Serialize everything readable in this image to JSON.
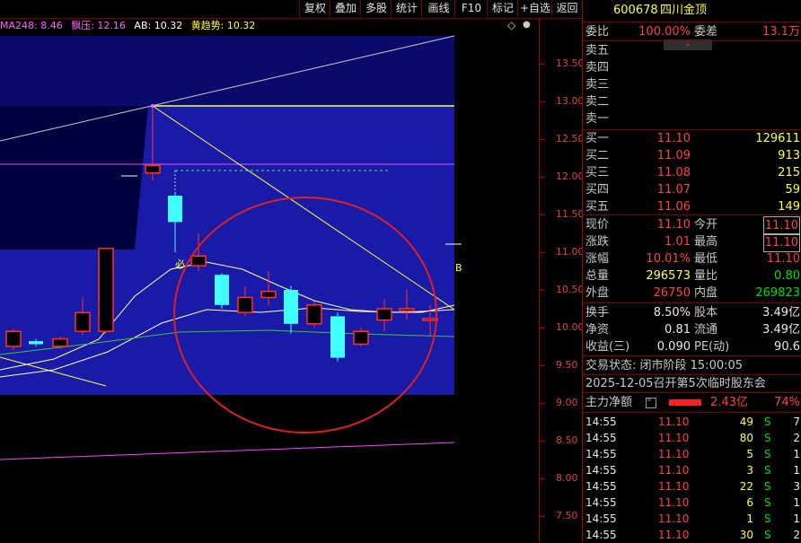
{
  "toolbar": {
    "buttons": [
      "复权",
      "叠加",
      "多股",
      "统计",
      "画线",
      "F10",
      "标记",
      "+自选",
      "返回"
    ]
  },
  "indicators": {
    "ma248": "MA248: 8.46",
    "piaoya": "飘压: 12.16",
    "ab": "AB: 10.32",
    "huang": "黄趋势: 10.32"
  },
  "chart_icons": {
    "diamond": "◇",
    "dot": "●"
  },
  "price_axis": {
    "ticks": [
      "13.50",
      "13.00",
      "12.50",
      "12.00",
      "11.50",
      "11.00",
      "10.50",
      "10.00",
      "9.50",
      "9.00",
      "8.50",
      "8.00",
      "7.50"
    ]
  },
  "chart_labels": {
    "signal": "必",
    "b_mark": "B"
  },
  "chart_data": {
    "type": "candlestick",
    "ylim": [
      7.25,
      13.85
    ],
    "candles": [
      {
        "o": 9.75,
        "c": 9.95,
        "h": 9.98,
        "l": 9.7
      },
      {
        "o": 9.82,
        "c": 9.78,
        "h": 9.85,
        "l": 9.75
      },
      {
        "o": 9.75,
        "c": 9.85,
        "h": 9.88,
        "l": 9.72
      },
      {
        "o": 9.95,
        "c": 10.2,
        "h": 10.4,
        "l": 9.9
      },
      {
        "o": 9.95,
        "c": 11.05,
        "h": 11.05,
        "l": 9.92
      },
      {
        "o": 12.05,
        "c": 12.15,
        "h": 12.95,
        "l": 11.95
      },
      {
        "o": 11.75,
        "c": 11.4,
        "h": 11.8,
        "l": 11.0
      },
      {
        "o": 10.82,
        "c": 10.95,
        "h": 11.25,
        "l": 10.75
      },
      {
        "o": 10.7,
        "c": 10.3,
        "h": 10.72,
        "l": 10.25
      },
      {
        "o": 10.2,
        "c": 10.4,
        "h": 10.55,
        "l": 10.15
      },
      {
        "o": 10.4,
        "c": 10.48,
        "h": 10.75,
        "l": 10.3
      },
      {
        "o": 10.5,
        "c": 10.05,
        "h": 10.55,
        "l": 9.92
      },
      {
        "o": 10.05,
        "c": 10.3,
        "h": 10.35,
        "l": 10.0
      },
      {
        "o": 10.15,
        "c": 9.6,
        "h": 10.2,
        "l": 9.55
      },
      {
        "o": 9.78,
        "c": 9.95,
        "h": 10.0,
        "l": 9.75
      },
      {
        "o": 10.1,
        "c": 10.25,
        "h": 10.38,
        "l": 9.95
      },
      {
        "o": 10.22,
        "c": 10.25,
        "h": 10.5,
        "l": 10.1
      },
      {
        "o": 10.1,
        "c": 10.12,
        "h": 10.3,
        "l": 9.9
      }
    ]
  },
  "panel": {
    "code": "600678",
    "name": "四川金顶",
    "weibi_label": "委比",
    "weibi": "100.00%",
    "weicha_label": "委差",
    "weicha": "13.1万",
    "sell": [
      {
        "label": "卖五"
      },
      {
        "label": "卖四"
      },
      {
        "label": "卖三"
      },
      {
        "label": "卖二"
      },
      {
        "label": "卖一"
      }
    ],
    "buy": [
      {
        "label": "买一",
        "price": "11.10",
        "vol": "129611"
      },
      {
        "label": "买二",
        "price": "11.09",
        "vol": "913"
      },
      {
        "label": "买三",
        "price": "11.08",
        "vol": "215"
      },
      {
        "label": "买四",
        "price": "11.07",
        "vol": "59"
      },
      {
        "label": "买五",
        "price": "11.06",
        "vol": "149"
      }
    ],
    "quote": [
      {
        "l1": "现价",
        "v1": "11.10",
        "l2": "今开",
        "v2": "11.10"
      },
      {
        "l1": "涨跌",
        "v1": "1.01",
        "l2": "最高",
        "v2": "11.10"
      },
      {
        "l1": "涨幅",
        "v1": "10.01%",
        "l2": "最低",
        "v2": "11.10"
      },
      {
        "l1": "总量",
        "v1": "296573",
        "l2": "量比",
        "v2": "0.80"
      },
      {
        "l1": "外盘",
        "v1": "26750",
        "l2": "内盘",
        "v2": "269823"
      }
    ],
    "fin": [
      {
        "l1": "换手",
        "v1": "8.50%",
        "l2": "股本",
        "v2": "3.49亿"
      },
      {
        "l1": "净资",
        "v1": "0.81",
        "l2": "流通",
        "v2": "3.49亿"
      },
      {
        "l1": "收益(三)",
        "v1": "0.090",
        "l2": "PE(动)",
        "v2": "90.6"
      }
    ],
    "status": "交易状态: 闭市阶段 15:00:05",
    "notice": "2025-12-05召开第5次临时股东会",
    "main_flow_label": "主力净额",
    "main_flow_value": "2.43亿",
    "main_flow_pct": "74%",
    "ticks": [
      {
        "t": "14:55",
        "p": "11.10",
        "v": "49",
        "s": "S",
        "n": "7"
      },
      {
        "t": "14:55",
        "p": "11.10",
        "v": "80",
        "s": "S",
        "n": "2"
      },
      {
        "t": "14:55",
        "p": "11.10",
        "v": "5",
        "s": "S",
        "n": "1"
      },
      {
        "t": "14:55",
        "p": "11.10",
        "v": "3",
        "s": "S",
        "n": "1"
      },
      {
        "t": "14:55",
        "p": "11.10",
        "v": "22",
        "s": "S",
        "n": "3"
      },
      {
        "t": "14:55",
        "p": "11.10",
        "v": "6",
        "s": "S",
        "n": "1"
      },
      {
        "t": "14:55",
        "p": "11.10",
        "v": "1",
        "s": "S",
        "n": "1"
      },
      {
        "t": "14:55",
        "p": "11.10",
        "v": "30",
        "s": "S",
        "n": "2"
      }
    ]
  }
}
